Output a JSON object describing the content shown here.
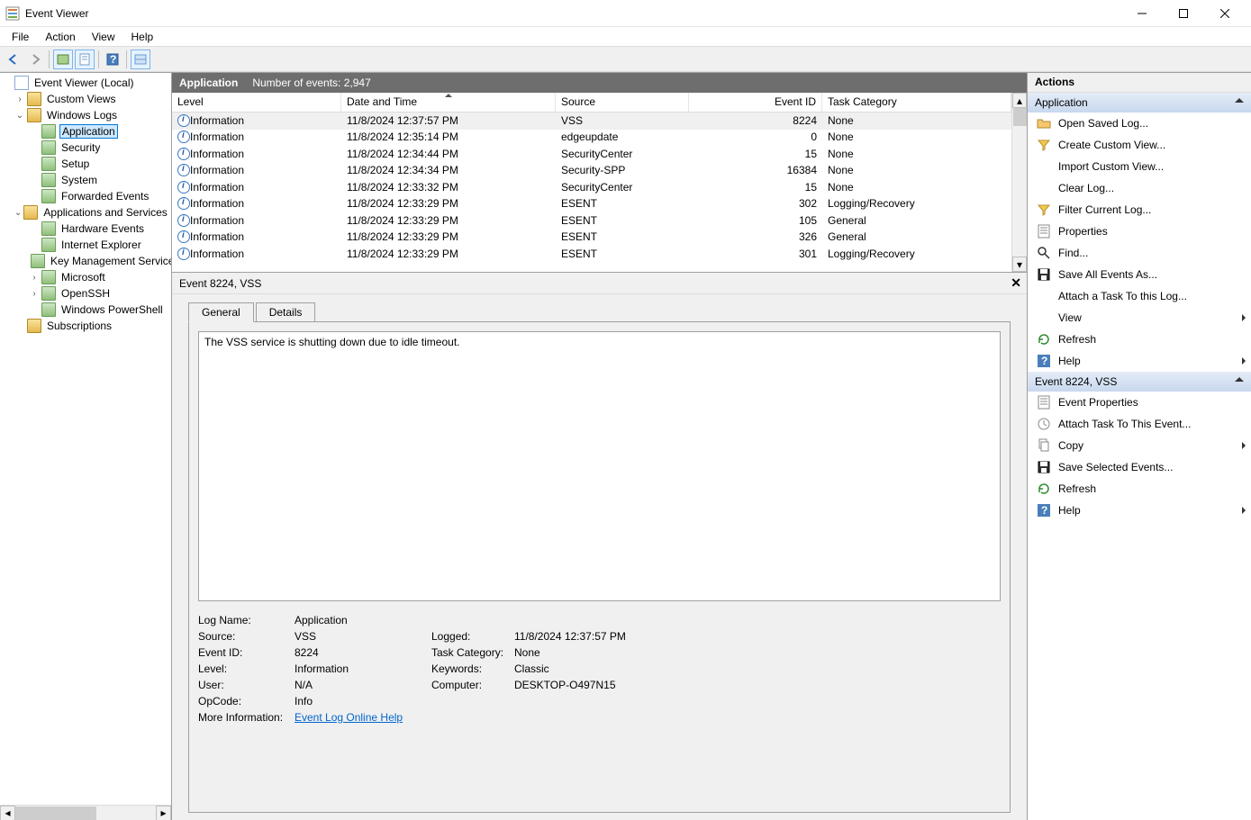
{
  "window": {
    "title": "Event Viewer"
  },
  "menu": [
    "File",
    "Action",
    "View",
    "Help"
  ],
  "tree": [
    {
      "label": "Event Viewer (Local)",
      "indent": 0,
      "toggle": "",
      "selected": false
    },
    {
      "label": "Custom Views",
      "indent": 1,
      "toggle": "›",
      "selected": false
    },
    {
      "label": "Windows Logs",
      "indent": 1,
      "toggle": "⌄",
      "selected": false
    },
    {
      "label": "Application",
      "indent": 2,
      "toggle": "",
      "selected": true
    },
    {
      "label": "Security",
      "indent": 2,
      "toggle": "",
      "selected": false
    },
    {
      "label": "Setup",
      "indent": 2,
      "toggle": "",
      "selected": false
    },
    {
      "label": "System",
      "indent": 2,
      "toggle": "",
      "selected": false
    },
    {
      "label": "Forwarded Events",
      "indent": 2,
      "toggle": "",
      "selected": false
    },
    {
      "label": "Applications and Services Logs",
      "indent": 1,
      "toggle": "⌄",
      "selected": false
    },
    {
      "label": "Hardware Events",
      "indent": 2,
      "toggle": "",
      "selected": false
    },
    {
      "label": "Internet Explorer",
      "indent": 2,
      "toggle": "",
      "selected": false
    },
    {
      "label": "Key Management Service",
      "indent": 2,
      "toggle": "",
      "selected": false
    },
    {
      "label": "Microsoft",
      "indent": 2,
      "toggle": "›",
      "selected": false
    },
    {
      "label": "OpenSSH",
      "indent": 2,
      "toggle": "›",
      "selected": false
    },
    {
      "label": "Windows PowerShell",
      "indent": 2,
      "toggle": "",
      "selected": false
    },
    {
      "label": "Subscriptions",
      "indent": 1,
      "toggle": "",
      "selected": false
    }
  ],
  "centerHeader": {
    "title": "Application",
    "count_label": "Number of events: 2,947"
  },
  "columns": {
    "level": "Level",
    "date": "Date and Time",
    "source": "Source",
    "eventid": "Event ID",
    "task": "Task Category"
  },
  "events": [
    {
      "level": "Information",
      "date": "11/8/2024 12:37:57 PM",
      "source": "VSS",
      "id": "8224",
      "task": "None",
      "selected": true
    },
    {
      "level": "Information",
      "date": "11/8/2024 12:35:14 PM",
      "source": "edgeupdate",
      "id": "0",
      "task": "None"
    },
    {
      "level": "Information",
      "date": "11/8/2024 12:34:44 PM",
      "source": "SecurityCenter",
      "id": "15",
      "task": "None"
    },
    {
      "level": "Information",
      "date": "11/8/2024 12:34:34 PM",
      "source": "Security-SPP",
      "id": "16384",
      "task": "None"
    },
    {
      "level": "Information",
      "date": "11/8/2024 12:33:32 PM",
      "source": "SecurityCenter",
      "id": "15",
      "task": "None"
    },
    {
      "level": "Information",
      "date": "11/8/2024 12:33:29 PM",
      "source": "ESENT",
      "id": "302",
      "task": "Logging/Recovery"
    },
    {
      "level": "Information",
      "date": "11/8/2024 12:33:29 PM",
      "source": "ESENT",
      "id": "105",
      "task": "General"
    },
    {
      "level": "Information",
      "date": "11/8/2024 12:33:29 PM",
      "source": "ESENT",
      "id": "326",
      "task": "General"
    },
    {
      "level": "Information",
      "date": "11/8/2024 12:33:29 PM",
      "source": "ESENT",
      "id": "301",
      "task": "Logging/Recovery"
    }
  ],
  "detail": {
    "title": "Event 8224, VSS",
    "tabs": {
      "general": "General",
      "details": "Details"
    },
    "description": "The VSS service is shutting down due to idle timeout.",
    "props": {
      "log_name_k": "Log Name:",
      "log_name_v": "Application",
      "source_k": "Source:",
      "source_v": "VSS",
      "logged_k": "Logged:",
      "logged_v": "11/8/2024 12:37:57 PM",
      "eventid_k": "Event ID:",
      "eventid_v": "8224",
      "taskcat_k": "Task Category:",
      "taskcat_v": "None",
      "level_k": "Level:",
      "level_v": "Information",
      "keywords_k": "Keywords:",
      "keywords_v": "Classic",
      "user_k": "User:",
      "user_v": "N/A",
      "computer_k": "Computer:",
      "computer_v": "DESKTOP-O497N15",
      "opcode_k": "OpCode:",
      "opcode_v": "Info",
      "moreinfo_k": "More Information:",
      "moreinfo_v": "Event Log Online Help"
    }
  },
  "actions": {
    "header": "Actions",
    "section1": "Application",
    "items1": [
      {
        "label": "Open Saved Log...",
        "icon": "folder-open-icon"
      },
      {
        "label": "Create Custom View...",
        "icon": "filter-icon"
      },
      {
        "label": "Import Custom View...",
        "icon": "blank-icon"
      },
      {
        "label": "Clear Log...",
        "icon": "blank-icon"
      },
      {
        "label": "Filter Current Log...",
        "icon": "filter-icon"
      },
      {
        "label": "Properties",
        "icon": "properties-icon"
      },
      {
        "label": "Find...",
        "icon": "find-icon"
      },
      {
        "label": "Save All Events As...",
        "icon": "save-icon"
      },
      {
        "label": "Attach a Task To this Log...",
        "icon": "blank-icon"
      },
      {
        "label": "View",
        "icon": "blank-icon",
        "submenu": true
      },
      {
        "label": "Refresh",
        "icon": "refresh-icon"
      },
      {
        "label": "Help",
        "icon": "help-icon",
        "submenu": true
      }
    ],
    "section2": "Event 8224, VSS",
    "items2": [
      {
        "label": "Event Properties",
        "icon": "properties-icon"
      },
      {
        "label": "Attach Task To This Event...",
        "icon": "task-icon"
      },
      {
        "label": "Copy",
        "icon": "copy-icon",
        "submenu": true
      },
      {
        "label": "Save Selected Events...",
        "icon": "save-icon"
      },
      {
        "label": "Refresh",
        "icon": "refresh-icon"
      },
      {
        "label": "Help",
        "icon": "help-icon",
        "submenu": true
      }
    ]
  }
}
